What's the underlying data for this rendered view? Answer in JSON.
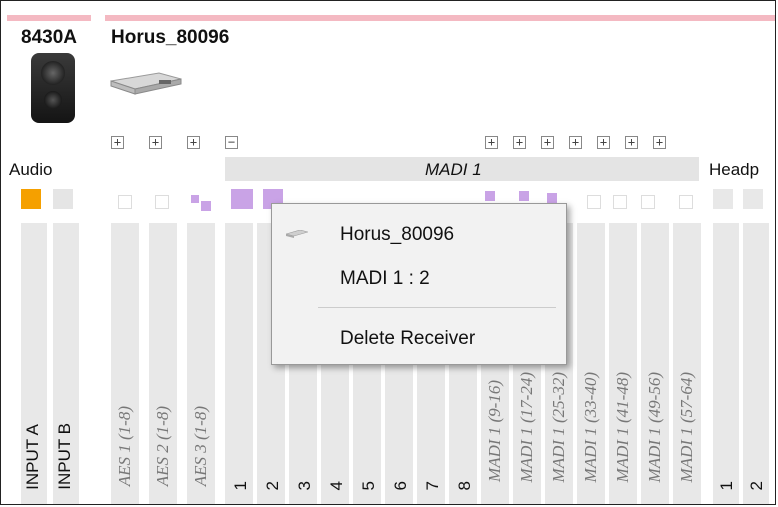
{
  "devices": [
    {
      "name": "8430A"
    },
    {
      "name": "Horus_80096"
    }
  ],
  "headers": {
    "audio": "Audio",
    "madi": "MADI 1",
    "headphones": "Headp"
  },
  "colors": {
    "accent_pink": "#f4b9c2",
    "active_orange": "#f5a000",
    "madi_purple": "#c9a3e6"
  },
  "columns": [
    {
      "label": "INPUT A"
    },
    {
      "label": "INPUT B"
    },
    {
      "label": "AES 1 (1-8)"
    },
    {
      "label": "AES 2 (1-8)"
    },
    {
      "label": "AES 3 (1-8)"
    },
    {
      "label": "1"
    },
    {
      "label": "2"
    },
    {
      "label": "3"
    },
    {
      "label": "4"
    },
    {
      "label": "5"
    },
    {
      "label": "6"
    },
    {
      "label": "7"
    },
    {
      "label": "8"
    },
    {
      "label": "MADI 1 (9-16)"
    },
    {
      "label": "MADI 1 (17-24)"
    },
    {
      "label": "MADI 1 (25-32)"
    },
    {
      "label": "MADI 1 (33-40)"
    },
    {
      "label": "MADI 1 (41-48)"
    },
    {
      "label": "MADI 1 (49-56)"
    },
    {
      "label": "MADI 1 (57-64)"
    },
    {
      "label": "1"
    },
    {
      "label": "2"
    }
  ],
  "context_menu": {
    "device": "Horus_80096",
    "channel": "MADI 1 : 2",
    "delete": "Delete Receiver"
  },
  "buttons": {
    "plus": "+",
    "minus": "−"
  }
}
